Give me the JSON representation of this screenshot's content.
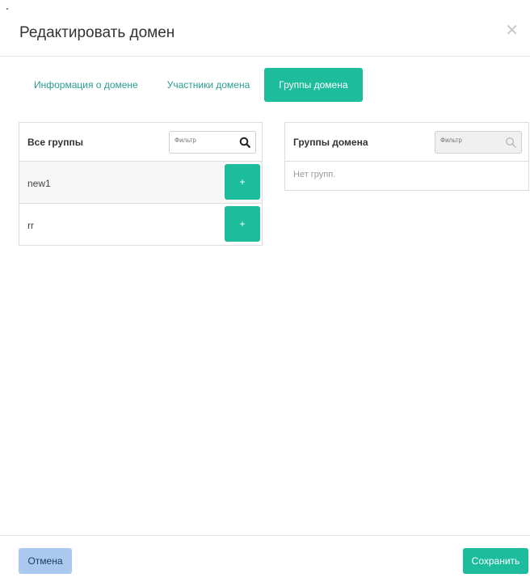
{
  "modal": {
    "title": "Редактировать домен",
    "close_icon": "close-icon"
  },
  "tabs": [
    {
      "label": "Информация о домене",
      "active": false
    },
    {
      "label": "Участники домена",
      "active": false
    },
    {
      "label": "Группы домена",
      "active": true
    }
  ],
  "all_groups": {
    "title": "Все группы",
    "filter_placeholder": "Фильтр",
    "items": [
      {
        "name": "new1",
        "add_label": "+"
      },
      {
        "name": "rr",
        "add_label": "+"
      }
    ]
  },
  "domain_groups": {
    "title": "Группы домена",
    "filter_placeholder": "Фильтр",
    "empty_text": "Нет групп."
  },
  "footer": {
    "cancel_label": "Отмена",
    "save_label": "Сохранить"
  },
  "colors": {
    "accent": "#1cbc9c",
    "tab_text": "#2a9d8f",
    "cancel_bg": "#aac8f0"
  }
}
